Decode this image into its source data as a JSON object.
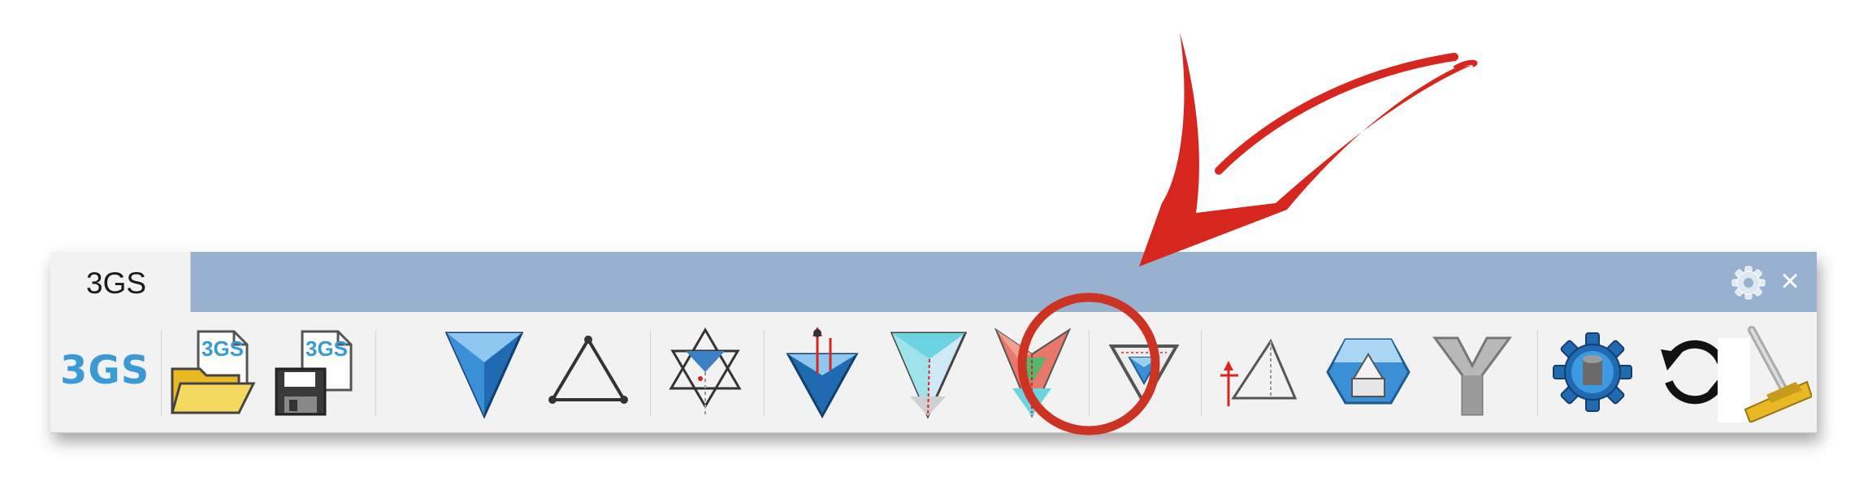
{
  "tab": {
    "label": "3GS"
  },
  "logo": {
    "text": "3GS"
  },
  "file_badge_text": "3GS",
  "icons": [
    "open-file-icon",
    "save-file-icon",
    "form-diagram-icon",
    "triangle-outline-icon",
    "dual-force-icon",
    "force-polyhedron-icon",
    "inverted-pyramid-icon",
    "colored-force-diagram-icon",
    "nested-triangle-icon",
    "triangle-dimension-icon",
    "polyhedron-cell-icon",
    "tripod-node-icon",
    "settings-gear-icon",
    "refresh-icon",
    "broom-clear-icon"
  ],
  "colors": {
    "tab_strip": "#97b1cf",
    "toolbar_bg": "#f2f2f2",
    "logo_blue": "#3a9ad6",
    "annotation_red": "#d7261e"
  },
  "annotation": {
    "highlighted_icon": "nested-triangle-icon"
  }
}
